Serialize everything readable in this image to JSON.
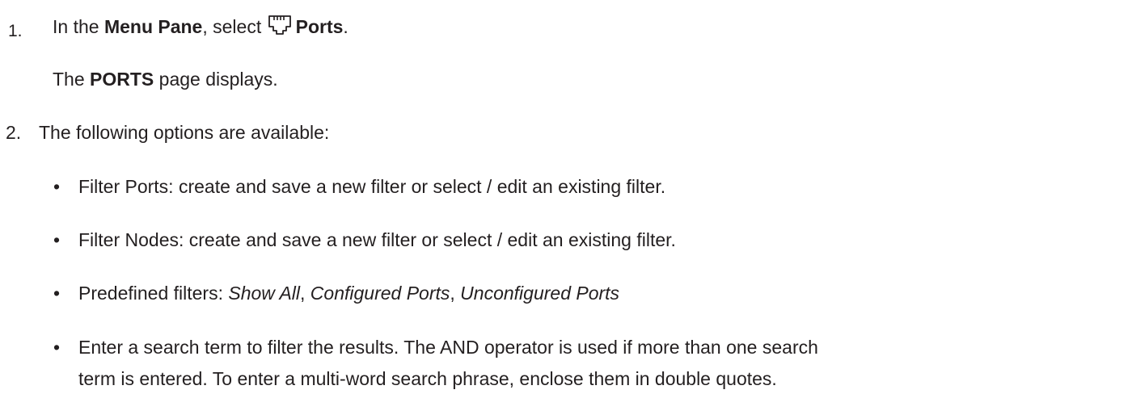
{
  "steps": [
    {
      "number": "1.",
      "text_pre": "In the ",
      "bold1": "Menu Pane",
      "text_mid": ", select ",
      "icon": "ethernet-port-icon",
      "bold2": "Ports",
      "text_post": ".",
      "result_pre": "The ",
      "result_bold": "PORTS",
      "result_post": " page displays."
    },
    {
      "number": "2.",
      "text": "The following options are available:",
      "bullets": [
        {
          "marker": "•",
          "text": "Filter Ports: create and save a new filter or select / edit an existing filter."
        },
        {
          "marker": "•",
          "text": "Filter Nodes: create and save a new filter or select / edit an existing filter."
        },
        {
          "marker": "•",
          "pre": "Predefined filters: ",
          "italic1": "Show All",
          "sep1": ", ",
          "italic2": "Configured Ports",
          "sep2": ", ",
          "italic3": "Unconfigured Ports"
        },
        {
          "marker": "•",
          "line1": "Enter a search term to filter the results. The AND operator is used if more than one search",
          "line2": "term is entered. To enter a multi-word search phrase, enclose them in double quotes."
        }
      ]
    }
  ]
}
